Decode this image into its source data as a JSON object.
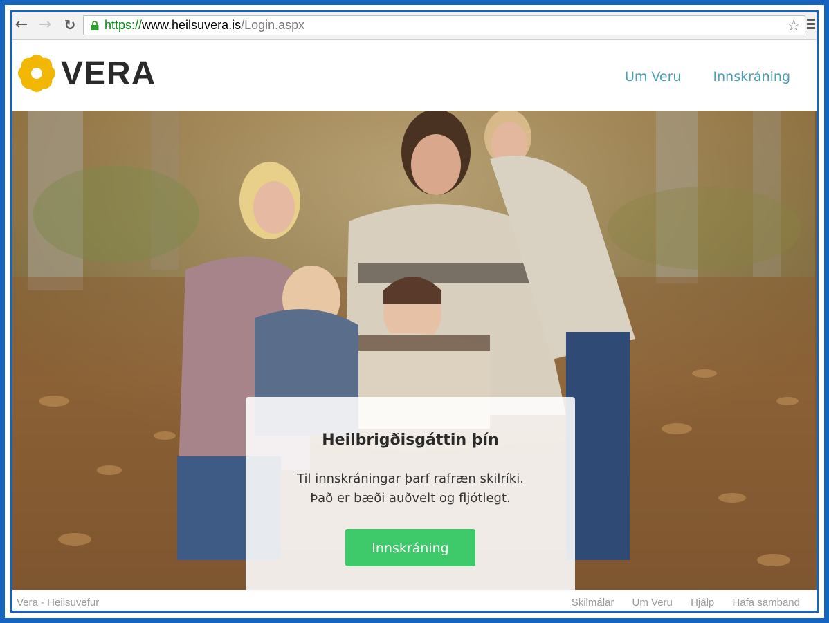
{
  "browser": {
    "url_scheme": "https://",
    "url_host": "www.heilsuvera.is",
    "url_path": "/Login.aspx",
    "icons": [
      "back-arrow-icon",
      "forward-arrow-icon",
      "reload-icon",
      "lock-icon",
      "star-icon",
      "menu-icon"
    ]
  },
  "header": {
    "logo_text": "VERA",
    "nav": [
      "Um Veru",
      "Innskráning"
    ]
  },
  "card": {
    "title": "Heilbrigðisgáttin þín",
    "text_line1": "Til innskráningar þarf rafræn skilríki.",
    "text_line2": "Það er bæði auðvelt og fljótlegt.",
    "button_label": "Innskráning"
  },
  "footer": {
    "left_text": "Vera - Heilsuvefur",
    "links": [
      "Skilmálar",
      "Um Veru",
      "Hjálp",
      "Hafa samband"
    ]
  },
  "colors": {
    "frame": "#1565c0",
    "nav_link": "#4a9db3",
    "button": "#3ec96a",
    "logo_flower": "#f2b705"
  }
}
